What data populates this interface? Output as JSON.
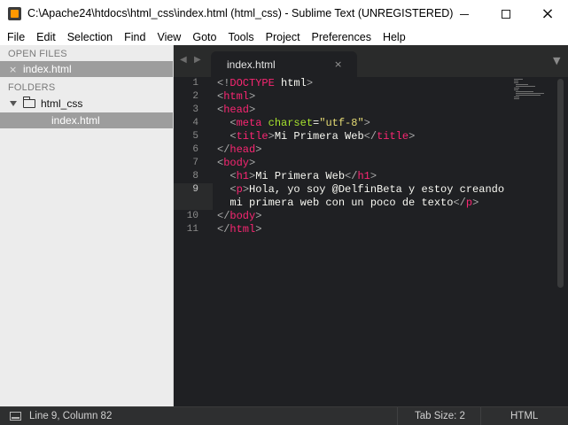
{
  "window": {
    "title": "C:\\Apache24\\htdocs\\html_css\\index.html (html_css) - Sublime Text (UNREGISTERED)",
    "app_icon": "sublime-text-icon"
  },
  "menu": [
    "File",
    "Edit",
    "Selection",
    "Find",
    "View",
    "Goto",
    "Tools",
    "Project",
    "Preferences",
    "Help"
  ],
  "sidebar": {
    "open_files_header": "OPEN FILES",
    "open_files": [
      {
        "label": "index.html",
        "close": "×"
      }
    ],
    "folders_header": "FOLDERS",
    "folders": [
      {
        "label": "html_css",
        "expanded": true,
        "files": [
          "index.html"
        ]
      }
    ]
  },
  "tabs": [
    {
      "label": "index.html",
      "close": "×",
      "active": true
    }
  ],
  "tab_nav": {
    "prev": "◀",
    "next": "▶",
    "dropdown": "▼"
  },
  "editor": {
    "line_numbers": [
      "1",
      "2",
      "3",
      "4",
      "5",
      "6",
      "7",
      "8",
      "9",
      "",
      "10",
      "11"
    ],
    "active_line": "9",
    "colors": {
      "tag": "#f92672",
      "attr": "#a6e22e",
      "string": "#e6db74",
      "text": "#f8f8f2",
      "background": "#1f2023"
    }
  },
  "status": {
    "position": "Line 9, Column 82",
    "tab_size": "Tab Size: 2",
    "syntax": "HTML"
  }
}
